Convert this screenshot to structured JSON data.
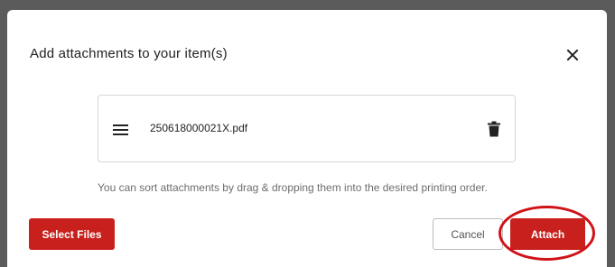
{
  "dialog": {
    "title": "Add attachments to your item(s)",
    "close_icon": "close-icon"
  },
  "attachments": [
    {
      "file_name": "250618000021X.pdf",
      "drag_icon": "drag-handle-icon",
      "delete_icon": "trash-icon"
    }
  ],
  "hint_text": "You can sort attachments by drag & dropping them into the desired printing order.",
  "buttons": {
    "select_files": "Select Files",
    "cancel": "Cancel",
    "attach": "Attach"
  },
  "colors": {
    "accent": "#c8201c",
    "highlight_ring": "#d01218",
    "overlay": "#5b5b5b"
  }
}
